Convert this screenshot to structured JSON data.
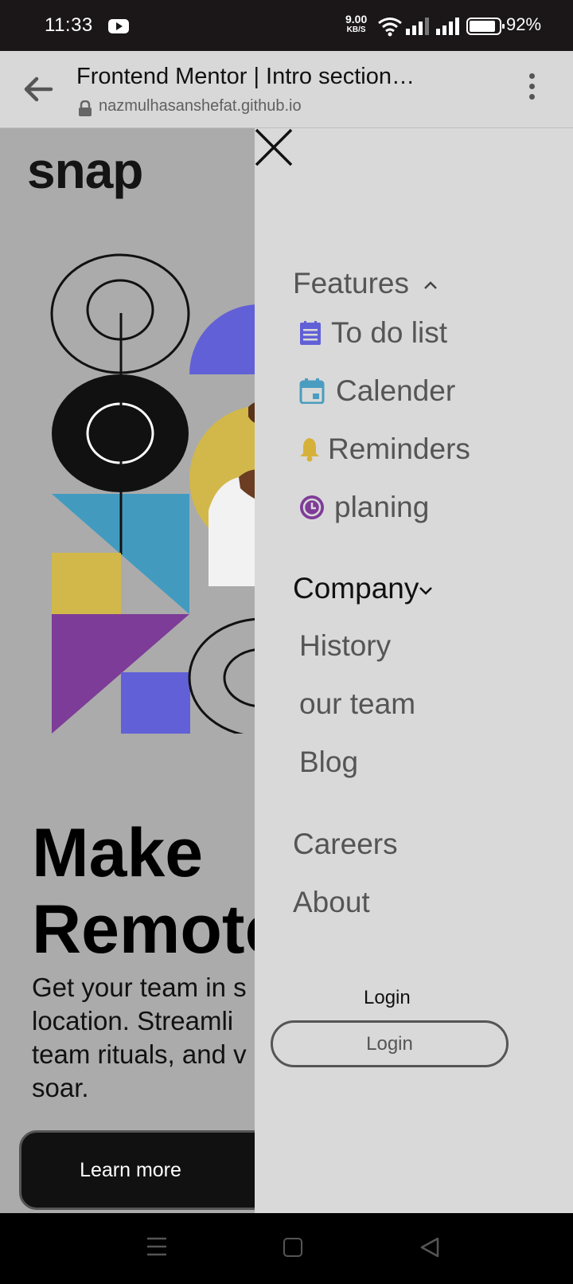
{
  "status_bar": {
    "time": "11:33",
    "net_speed_value": "9.00",
    "net_speed_unit": "KB/S",
    "battery_level": 92,
    "battery_text": "92%"
  },
  "browser": {
    "title": "Frontend Mentor | Intro section…",
    "url": "nazmulhasanshefat.github.io"
  },
  "page": {
    "logo": "snap",
    "hero_line1": "Make",
    "hero_line2": "Remote",
    "hero_text": "Get your team in s location. Streamli team rituals, and v soar.",
    "learn_more": "Learn more"
  },
  "drawer": {
    "features": {
      "label": "Features",
      "items": [
        {
          "label": "To do list",
          "icon": "todo-list-icon",
          "color": "#6260d6"
        },
        {
          "label": "Calender",
          "icon": "calendar-icon",
          "color": "#4a9dc0"
        },
        {
          "label": "Reminders",
          "icon": "bell-icon",
          "color": "#d6b13a"
        },
        {
          "label": "planing",
          "icon": "clock-icon",
          "color": "#7e3c98"
        }
      ]
    },
    "company": {
      "label": "Company",
      "items": [
        "History",
        "our team",
        "Blog"
      ]
    },
    "careers": "Careers",
    "about": "About",
    "login_label": "Login",
    "login_button": "Login"
  },
  "colors": {
    "purple": "#6260d6",
    "blue": "#429bbf",
    "yellow": "#d2b84a",
    "violet": "#7d3c98",
    "page_bg": "#ababab",
    "drawer_bg": "#d9d9d9"
  }
}
